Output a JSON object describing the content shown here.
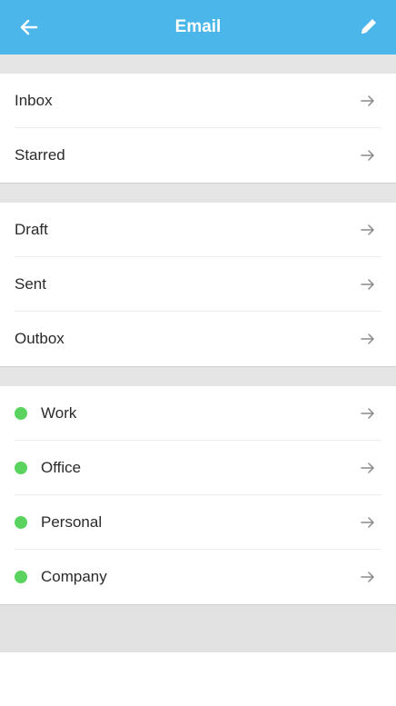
{
  "header": {
    "title": "Email",
    "back_icon": "arrow-left-icon",
    "edit_icon": "pencil-icon",
    "background": "#4ab6ea"
  },
  "groups": [
    {
      "items": [
        {
          "label": "Inbox"
        },
        {
          "label": "Starred"
        }
      ]
    },
    {
      "items": [
        {
          "label": "Draft"
        },
        {
          "label": "Sent"
        },
        {
          "label": "Outbox"
        }
      ]
    },
    {
      "items": [
        {
          "label": "Work",
          "dot_color": "#5ad45f"
        },
        {
          "label": "Office",
          "dot_color": "#5ad45f"
        },
        {
          "label": "Personal",
          "dot_color": "#5ad45f"
        },
        {
          "label": "Company",
          "dot_color": "#5ad45f"
        }
      ]
    }
  ],
  "arrow_icon": "arrow-right-icon"
}
